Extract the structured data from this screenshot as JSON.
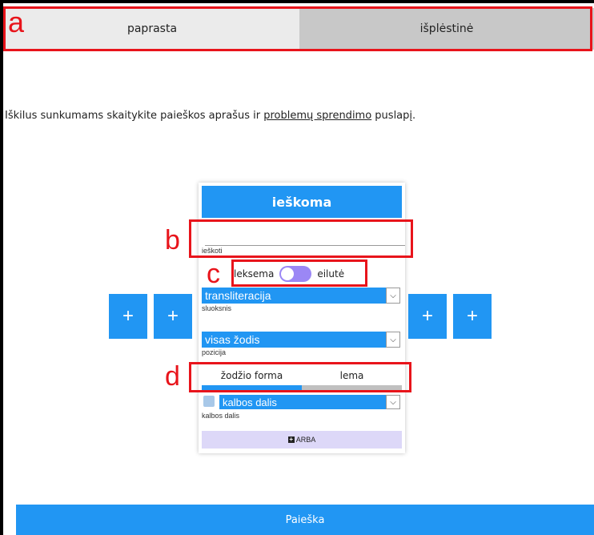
{
  "tabs": {
    "simple": "paprasta",
    "advanced": "išplėstinė"
  },
  "help": {
    "before": "Iškilus sunkumams skaitykite paieškos aprašus ir ",
    "link": "problemų sprendimo",
    "after": " puslapį."
  },
  "panel": {
    "header": "ieškoma",
    "search": {
      "value": "",
      "label": "ieškoti"
    },
    "toggle": {
      "left": "leksema",
      "right": "eilutė"
    },
    "layer": {
      "selected": "transliteracija",
      "label": "sluoksnis"
    },
    "position": {
      "selected": "visas žodis",
      "label": "pozicija"
    },
    "word_tabs": {
      "form": "žodžio forma",
      "lemma": "lema",
      "active_fraction": 0.5
    },
    "pos": {
      "selected": "kalbos dalis",
      "label": "kalbos dalis"
    },
    "or_button": "ARBA"
  },
  "plus_buttons": [
    "+",
    "+",
    "+",
    "+"
  ],
  "annotations": {
    "a": "a",
    "b": "b",
    "c": "c",
    "d": "d"
  },
  "search_button": "Paieška",
  "colors": {
    "accent": "#2196f3",
    "annotation": "#e8141b",
    "toggle": "#9b87f5",
    "or_button": "#ddd8f8"
  }
}
